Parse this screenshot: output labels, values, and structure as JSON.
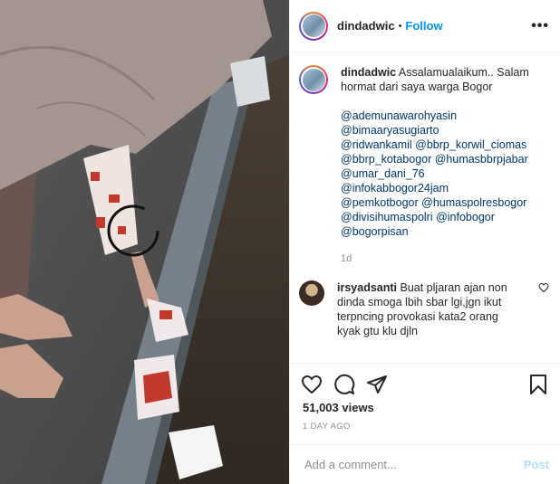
{
  "post": {
    "username": "dindadwic",
    "follow_label": "Follow",
    "separator": "•",
    "more_label": "•••"
  },
  "caption": {
    "username": "dindadwic",
    "lines": [
      "Assalamualaikum.. Salam",
      "hormat dari saya warga Bogor"
    ],
    "mentions": [
      "@ademunawarohyasin",
      "@bimaaryasugiarto",
      "@ridwankamil @bbrp_korwil_ciomas",
      "@bbrp_kotabogor @humasbbrpjabar",
      "@umar_dani_76",
      "@infokabbogor24jam",
      "@pemkotbogor @humaspolresbogor",
      "@divisihumaspolri @infobogor",
      "@bogorpisan"
    ],
    "time": "1d"
  },
  "comment": {
    "username": "irsyadsanti",
    "lines": [
      "Buat pljaran ajan non",
      "dinda smoga lbih sbar lgi,jgn ikut",
      "terpncing provokasi kata2 orang",
      "kyak gtu klu djln"
    ]
  },
  "stats": {
    "views": "51,003 views",
    "ago": "1 DAY AGO"
  },
  "composer": {
    "placeholder": "Add a comment...",
    "post_label": "Post"
  },
  "icons": {
    "like": "heart-icon",
    "comment": "comment-icon",
    "share": "share-icon",
    "save": "bookmark-icon",
    "comment_like": "heart-icon"
  },
  "colors": {
    "follow": "#0095f6",
    "post_disabled": "#b2dffc",
    "mention": "#00376b",
    "muted": "#8e8e8e"
  }
}
